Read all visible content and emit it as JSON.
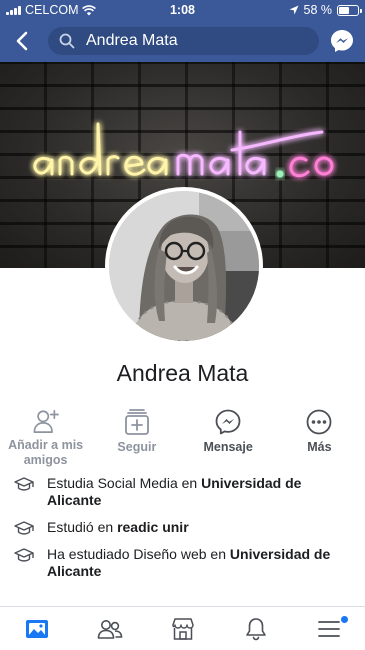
{
  "status_bar": {
    "carrier": "CELCOM",
    "time": "1:08",
    "battery": "58 %",
    "battery_level": 0.58
  },
  "nav": {
    "search_value": "Andrea Mata"
  },
  "cover": {
    "sign_text": "andreamata.co"
  },
  "profile": {
    "name": "Andrea Mata"
  },
  "actions": [
    {
      "label": "Añadir a mis amigos",
      "icon": "add-friend-icon"
    },
    {
      "label": "Seguir",
      "icon": "follow-icon"
    },
    {
      "label": "Mensaje",
      "icon": "messenger-icon"
    },
    {
      "label": "Más",
      "icon": "more-icon"
    }
  ],
  "intro": [
    {
      "prefix": "Estudia Social Media en ",
      "bold": "Universidad de Alicante"
    },
    {
      "prefix": "Estudió en ",
      "bold": "readic unir"
    },
    {
      "prefix": "Ha estudiado Diseño web en ",
      "bold": "Universidad de Alicante"
    }
  ],
  "tabs": [
    {
      "name": "news-feed",
      "icon": "news-feed-icon",
      "active": true
    },
    {
      "name": "friends",
      "icon": "friends-icon"
    },
    {
      "name": "marketplace",
      "icon": "marketplace-icon"
    },
    {
      "name": "notifications",
      "icon": "bell-icon"
    },
    {
      "name": "menu",
      "icon": "menu-icon",
      "badge": true
    }
  ],
  "colors": {
    "brand": "#3b5998",
    "search_bg": "#2f4b82",
    "accent": "#1877f2",
    "muted": "#8d949e"
  }
}
